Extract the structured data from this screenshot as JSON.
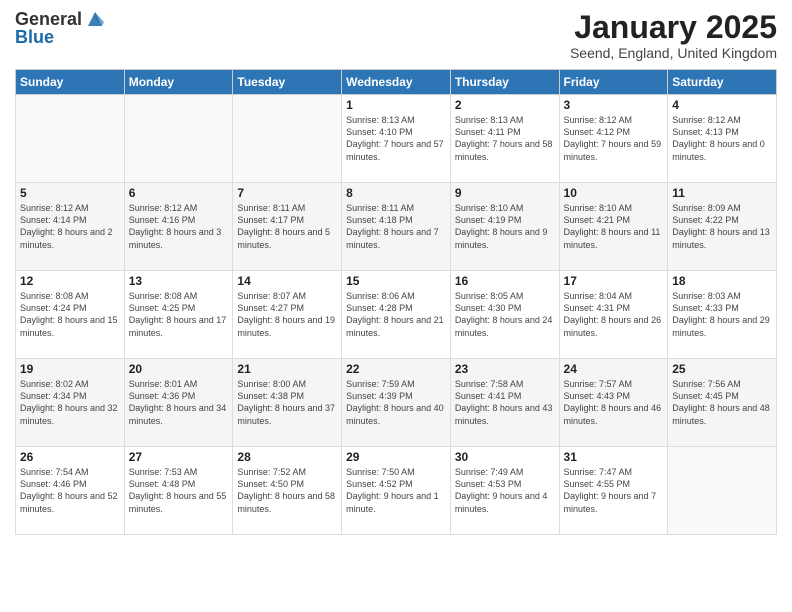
{
  "header": {
    "logo_general": "General",
    "logo_blue": "Blue",
    "month": "January 2025",
    "location": "Seend, England, United Kingdom"
  },
  "weekdays": [
    "Sunday",
    "Monday",
    "Tuesday",
    "Wednesday",
    "Thursday",
    "Friday",
    "Saturday"
  ],
  "weeks": [
    [
      {
        "day": "",
        "info": ""
      },
      {
        "day": "",
        "info": ""
      },
      {
        "day": "",
        "info": ""
      },
      {
        "day": "1",
        "info": "Sunrise: 8:13 AM\nSunset: 4:10 PM\nDaylight: 7 hours and 57 minutes."
      },
      {
        "day": "2",
        "info": "Sunrise: 8:13 AM\nSunset: 4:11 PM\nDaylight: 7 hours and 58 minutes."
      },
      {
        "day": "3",
        "info": "Sunrise: 8:12 AM\nSunset: 4:12 PM\nDaylight: 7 hours and 59 minutes."
      },
      {
        "day": "4",
        "info": "Sunrise: 8:12 AM\nSunset: 4:13 PM\nDaylight: 8 hours and 0 minutes."
      }
    ],
    [
      {
        "day": "5",
        "info": "Sunrise: 8:12 AM\nSunset: 4:14 PM\nDaylight: 8 hours and 2 minutes."
      },
      {
        "day": "6",
        "info": "Sunrise: 8:12 AM\nSunset: 4:16 PM\nDaylight: 8 hours and 3 minutes."
      },
      {
        "day": "7",
        "info": "Sunrise: 8:11 AM\nSunset: 4:17 PM\nDaylight: 8 hours and 5 minutes."
      },
      {
        "day": "8",
        "info": "Sunrise: 8:11 AM\nSunset: 4:18 PM\nDaylight: 8 hours and 7 minutes."
      },
      {
        "day": "9",
        "info": "Sunrise: 8:10 AM\nSunset: 4:19 PM\nDaylight: 8 hours and 9 minutes."
      },
      {
        "day": "10",
        "info": "Sunrise: 8:10 AM\nSunset: 4:21 PM\nDaylight: 8 hours and 11 minutes."
      },
      {
        "day": "11",
        "info": "Sunrise: 8:09 AM\nSunset: 4:22 PM\nDaylight: 8 hours and 13 minutes."
      }
    ],
    [
      {
        "day": "12",
        "info": "Sunrise: 8:08 AM\nSunset: 4:24 PM\nDaylight: 8 hours and 15 minutes."
      },
      {
        "day": "13",
        "info": "Sunrise: 8:08 AM\nSunset: 4:25 PM\nDaylight: 8 hours and 17 minutes."
      },
      {
        "day": "14",
        "info": "Sunrise: 8:07 AM\nSunset: 4:27 PM\nDaylight: 8 hours and 19 minutes."
      },
      {
        "day": "15",
        "info": "Sunrise: 8:06 AM\nSunset: 4:28 PM\nDaylight: 8 hours and 21 minutes."
      },
      {
        "day": "16",
        "info": "Sunrise: 8:05 AM\nSunset: 4:30 PM\nDaylight: 8 hours and 24 minutes."
      },
      {
        "day": "17",
        "info": "Sunrise: 8:04 AM\nSunset: 4:31 PM\nDaylight: 8 hours and 26 minutes."
      },
      {
        "day": "18",
        "info": "Sunrise: 8:03 AM\nSunset: 4:33 PM\nDaylight: 8 hours and 29 minutes."
      }
    ],
    [
      {
        "day": "19",
        "info": "Sunrise: 8:02 AM\nSunset: 4:34 PM\nDaylight: 8 hours and 32 minutes."
      },
      {
        "day": "20",
        "info": "Sunrise: 8:01 AM\nSunset: 4:36 PM\nDaylight: 8 hours and 34 minutes."
      },
      {
        "day": "21",
        "info": "Sunrise: 8:00 AM\nSunset: 4:38 PM\nDaylight: 8 hours and 37 minutes."
      },
      {
        "day": "22",
        "info": "Sunrise: 7:59 AM\nSunset: 4:39 PM\nDaylight: 8 hours and 40 minutes."
      },
      {
        "day": "23",
        "info": "Sunrise: 7:58 AM\nSunset: 4:41 PM\nDaylight: 8 hours and 43 minutes."
      },
      {
        "day": "24",
        "info": "Sunrise: 7:57 AM\nSunset: 4:43 PM\nDaylight: 8 hours and 46 minutes."
      },
      {
        "day": "25",
        "info": "Sunrise: 7:56 AM\nSunset: 4:45 PM\nDaylight: 8 hours and 48 minutes."
      }
    ],
    [
      {
        "day": "26",
        "info": "Sunrise: 7:54 AM\nSunset: 4:46 PM\nDaylight: 8 hours and 52 minutes."
      },
      {
        "day": "27",
        "info": "Sunrise: 7:53 AM\nSunset: 4:48 PM\nDaylight: 8 hours and 55 minutes."
      },
      {
        "day": "28",
        "info": "Sunrise: 7:52 AM\nSunset: 4:50 PM\nDaylight: 8 hours and 58 minutes."
      },
      {
        "day": "29",
        "info": "Sunrise: 7:50 AM\nSunset: 4:52 PM\nDaylight: 9 hours and 1 minute."
      },
      {
        "day": "30",
        "info": "Sunrise: 7:49 AM\nSunset: 4:53 PM\nDaylight: 9 hours and 4 minutes."
      },
      {
        "day": "31",
        "info": "Sunrise: 7:47 AM\nSunset: 4:55 PM\nDaylight: 9 hours and 7 minutes."
      },
      {
        "day": "",
        "info": ""
      }
    ]
  ]
}
